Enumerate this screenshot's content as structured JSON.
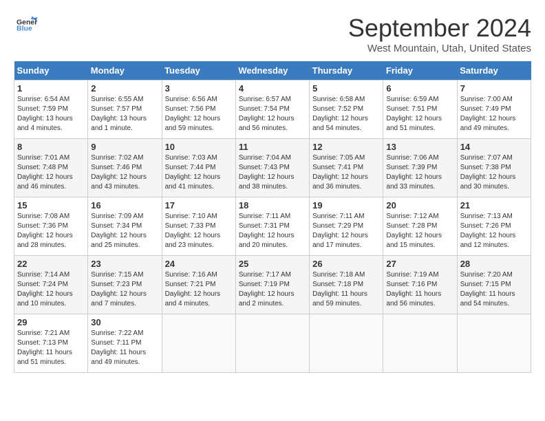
{
  "header": {
    "logo_line1": "General",
    "logo_line2": "Blue",
    "title": "September 2024",
    "location": "West Mountain, Utah, United States"
  },
  "calendar": {
    "days_of_week": [
      "Sunday",
      "Monday",
      "Tuesday",
      "Wednesday",
      "Thursday",
      "Friday",
      "Saturday"
    ],
    "weeks": [
      [
        {
          "day": "1",
          "info": "Sunrise: 6:54 AM\nSunset: 7:59 PM\nDaylight: 13 hours\nand 4 minutes."
        },
        {
          "day": "2",
          "info": "Sunrise: 6:55 AM\nSunset: 7:57 PM\nDaylight: 13 hours\nand 1 minute."
        },
        {
          "day": "3",
          "info": "Sunrise: 6:56 AM\nSunset: 7:56 PM\nDaylight: 12 hours\nand 59 minutes."
        },
        {
          "day": "4",
          "info": "Sunrise: 6:57 AM\nSunset: 7:54 PM\nDaylight: 12 hours\nand 56 minutes."
        },
        {
          "day": "5",
          "info": "Sunrise: 6:58 AM\nSunset: 7:52 PM\nDaylight: 12 hours\nand 54 minutes."
        },
        {
          "day": "6",
          "info": "Sunrise: 6:59 AM\nSunset: 7:51 PM\nDaylight: 12 hours\nand 51 minutes."
        },
        {
          "day": "7",
          "info": "Sunrise: 7:00 AM\nSunset: 7:49 PM\nDaylight: 12 hours\nand 49 minutes."
        }
      ],
      [
        {
          "day": "8",
          "info": "Sunrise: 7:01 AM\nSunset: 7:48 PM\nDaylight: 12 hours\nand 46 minutes."
        },
        {
          "day": "9",
          "info": "Sunrise: 7:02 AM\nSunset: 7:46 PM\nDaylight: 12 hours\nand 43 minutes."
        },
        {
          "day": "10",
          "info": "Sunrise: 7:03 AM\nSunset: 7:44 PM\nDaylight: 12 hours\nand 41 minutes."
        },
        {
          "day": "11",
          "info": "Sunrise: 7:04 AM\nSunset: 7:43 PM\nDaylight: 12 hours\nand 38 minutes."
        },
        {
          "day": "12",
          "info": "Sunrise: 7:05 AM\nSunset: 7:41 PM\nDaylight: 12 hours\nand 36 minutes."
        },
        {
          "day": "13",
          "info": "Sunrise: 7:06 AM\nSunset: 7:39 PM\nDaylight: 12 hours\nand 33 minutes."
        },
        {
          "day": "14",
          "info": "Sunrise: 7:07 AM\nSunset: 7:38 PM\nDaylight: 12 hours\nand 30 minutes."
        }
      ],
      [
        {
          "day": "15",
          "info": "Sunrise: 7:08 AM\nSunset: 7:36 PM\nDaylight: 12 hours\nand 28 minutes."
        },
        {
          "day": "16",
          "info": "Sunrise: 7:09 AM\nSunset: 7:34 PM\nDaylight: 12 hours\nand 25 minutes."
        },
        {
          "day": "17",
          "info": "Sunrise: 7:10 AM\nSunset: 7:33 PM\nDaylight: 12 hours\nand 23 minutes."
        },
        {
          "day": "18",
          "info": "Sunrise: 7:11 AM\nSunset: 7:31 PM\nDaylight: 12 hours\nand 20 minutes."
        },
        {
          "day": "19",
          "info": "Sunrise: 7:11 AM\nSunset: 7:29 PM\nDaylight: 12 hours\nand 17 minutes."
        },
        {
          "day": "20",
          "info": "Sunrise: 7:12 AM\nSunset: 7:28 PM\nDaylight: 12 hours\nand 15 minutes."
        },
        {
          "day": "21",
          "info": "Sunrise: 7:13 AM\nSunset: 7:26 PM\nDaylight: 12 hours\nand 12 minutes."
        }
      ],
      [
        {
          "day": "22",
          "info": "Sunrise: 7:14 AM\nSunset: 7:24 PM\nDaylight: 12 hours\nand 10 minutes."
        },
        {
          "day": "23",
          "info": "Sunrise: 7:15 AM\nSunset: 7:23 PM\nDaylight: 12 hours\nand 7 minutes."
        },
        {
          "day": "24",
          "info": "Sunrise: 7:16 AM\nSunset: 7:21 PM\nDaylight: 12 hours\nand 4 minutes."
        },
        {
          "day": "25",
          "info": "Sunrise: 7:17 AM\nSunset: 7:19 PM\nDaylight: 12 hours\nand 2 minutes."
        },
        {
          "day": "26",
          "info": "Sunrise: 7:18 AM\nSunset: 7:18 PM\nDaylight: 11 hours\nand 59 minutes."
        },
        {
          "day": "27",
          "info": "Sunrise: 7:19 AM\nSunset: 7:16 PM\nDaylight: 11 hours\nand 56 minutes."
        },
        {
          "day": "28",
          "info": "Sunrise: 7:20 AM\nSunset: 7:15 PM\nDaylight: 11 hours\nand 54 minutes."
        }
      ],
      [
        {
          "day": "29",
          "info": "Sunrise: 7:21 AM\nSunset: 7:13 PM\nDaylight: 11 hours\nand 51 minutes."
        },
        {
          "day": "30",
          "info": "Sunrise: 7:22 AM\nSunset: 7:11 PM\nDaylight: 11 hours\nand 49 minutes."
        },
        {
          "day": "",
          "info": ""
        },
        {
          "day": "",
          "info": ""
        },
        {
          "day": "",
          "info": ""
        },
        {
          "day": "",
          "info": ""
        },
        {
          "day": "",
          "info": ""
        }
      ]
    ]
  }
}
